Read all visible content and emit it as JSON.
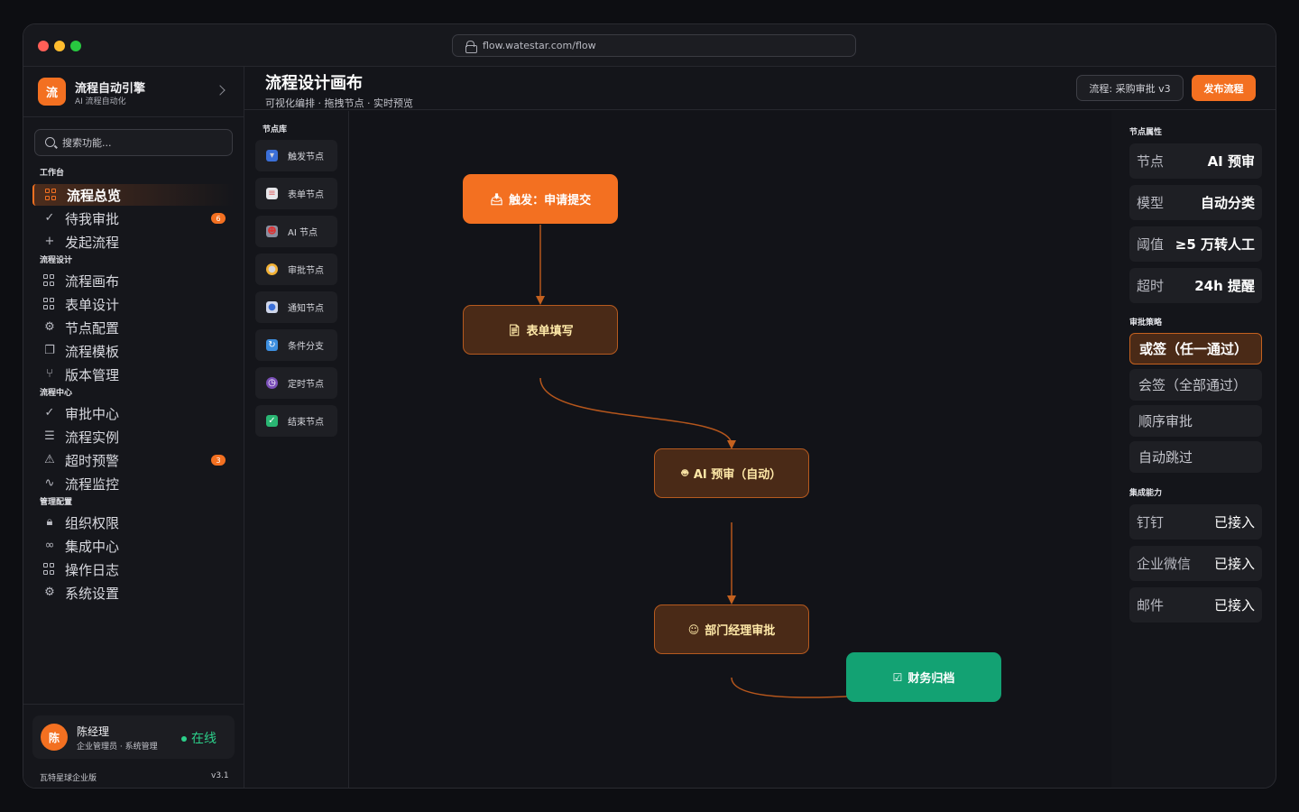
{
  "browser": {
    "url": "flow.watestar.com/flow"
  },
  "brand": {
    "logo": "流",
    "name": "流程自动引擎",
    "subtitle": "AI 流程自动化"
  },
  "search": {
    "placeholder": "搜索功能..."
  },
  "nav": {
    "sections": [
      {
        "title": "工作台",
        "items": [
          {
            "label": "流程总览",
            "icon": "grid-icon",
            "active": true
          },
          {
            "label": "待我审批",
            "icon": "check-circle-icon",
            "badge": "6"
          },
          {
            "label": "发起流程",
            "icon": "plus-icon"
          }
        ]
      },
      {
        "title": "流程设计",
        "items": [
          {
            "label": "流程画布",
            "icon": "grid-icon"
          },
          {
            "label": "表单设计",
            "icon": "grid-icon"
          },
          {
            "label": "节点配置",
            "icon": "gear-icon"
          },
          {
            "label": "流程模板",
            "icon": "copy-icon"
          },
          {
            "label": "版本管理",
            "icon": "branch-icon"
          }
        ]
      },
      {
        "title": "流程中心",
        "items": [
          {
            "label": "审批中心",
            "icon": "check-icon"
          },
          {
            "label": "流程实例",
            "icon": "list-icon"
          },
          {
            "label": "超时预警",
            "icon": "warning-icon",
            "badge": "3"
          },
          {
            "label": "流程监控",
            "icon": "pulse-icon"
          }
        ]
      },
      {
        "title": "管理配置",
        "items": [
          {
            "label": "组织权限",
            "icon": "lock-icon"
          },
          {
            "label": "集成中心",
            "icon": "link-icon"
          },
          {
            "label": "操作日志",
            "icon": "grid-icon"
          },
          {
            "label": "系统设置",
            "icon": "gear-icon"
          }
        ]
      }
    ]
  },
  "user": {
    "avatar": "陈",
    "name": "陈经理",
    "role": "企业管理员 · 系统管理",
    "status": "在线",
    "edition": "瓦特星球企业版",
    "version": "v3.1"
  },
  "header": {
    "title": "流程设计画布",
    "subtitle": "可视化编排 · 拖拽节点 · 实时预览",
    "version_pill": "流程: 采购审批 v3",
    "publish_label": "发布流程"
  },
  "palette": {
    "title": "节点库",
    "items": [
      {
        "label": "触发节点",
        "icon": "inbox-icon"
      },
      {
        "label": "表单节点",
        "icon": "document-icon"
      },
      {
        "label": "AI 节点",
        "icon": "robot-icon"
      },
      {
        "label": "审批节点",
        "icon": "person-icon"
      },
      {
        "label": "通知节点",
        "icon": "bell-icon"
      },
      {
        "label": "条件分支",
        "icon": "branch-icon"
      },
      {
        "label": "定时节点",
        "icon": "clock-icon"
      },
      {
        "label": "结束节点",
        "icon": "check-box-icon"
      }
    ]
  },
  "canvas": {
    "nodes": [
      {
        "label": "触发：申请提交",
        "icon": "inbox-icon",
        "kind": "trigger"
      },
      {
        "label": "表单填写",
        "icon": "document-icon",
        "kind": "task"
      },
      {
        "label": "AI 预审（自动）",
        "icon": "robot-icon",
        "kind": "task"
      },
      {
        "label": "部门经理审批",
        "icon": "person-icon",
        "kind": "task"
      },
      {
        "label": "财务归档",
        "icon": "check-box-icon",
        "kind": "end"
      }
    ]
  },
  "props": {
    "node_section": "节点属性",
    "node_props": [
      {
        "key": "节点",
        "value": "AI 预审"
      },
      {
        "key": "模型",
        "value": "自动分类"
      },
      {
        "key": "阈值",
        "value": "≥5 万转人工"
      },
      {
        "key": "超时",
        "value": "24h 提醒"
      }
    ],
    "strategy_section": "审批策略",
    "strategies": [
      {
        "label": "或签（任一通过）",
        "selected": true
      },
      {
        "label": "会签（全部通过）"
      },
      {
        "label": "顺序审批"
      },
      {
        "label": "自动跳过"
      }
    ],
    "integration_section": "集成能力",
    "integrations": [
      {
        "name": "钉钉",
        "status": "已接入"
      },
      {
        "name": "企业微信",
        "status": "已接入"
      },
      {
        "name": "邮件",
        "status": "已接入"
      }
    ]
  },
  "colors": {
    "accent": "#f37021",
    "success": "#13a273",
    "node_bg": "#4a2a17",
    "online": "#2ccf8a"
  }
}
